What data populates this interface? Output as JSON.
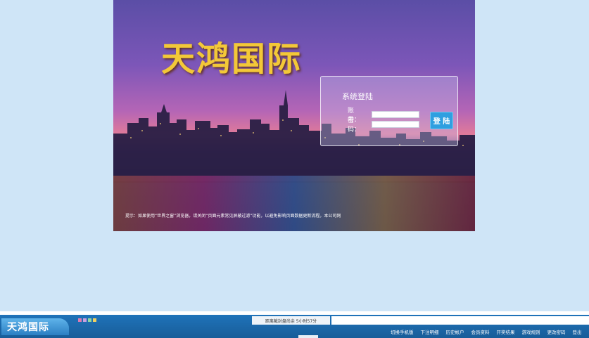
{
  "hero": {
    "brand": "天鸿国际",
    "tip": "提示：如果使用“世界之窗”浏览器，请关闭“页面元素常见屏蔽过滤”功能，以避免影响页面数据更新流程。本公司网"
  },
  "login": {
    "title": "系统登陆",
    "account_label": "账　号：",
    "password_label": "密　码：",
    "account_value": "",
    "password_value": "",
    "submit_label": "登 陆"
  },
  "bottom": {
    "logo": "天鸿国际",
    "marquee": "距离截封盘尚余 5小时57分",
    "color_squares": [
      "#e07bb0",
      "#c8a0e0",
      "#8fd8a0",
      "#f0d060"
    ],
    "nav": [
      "切换手机版",
      "下注明细",
      "历史帐户",
      "会员资料",
      "开奖结果",
      "游戏规则",
      "更改密码",
      "登出"
    ]
  }
}
